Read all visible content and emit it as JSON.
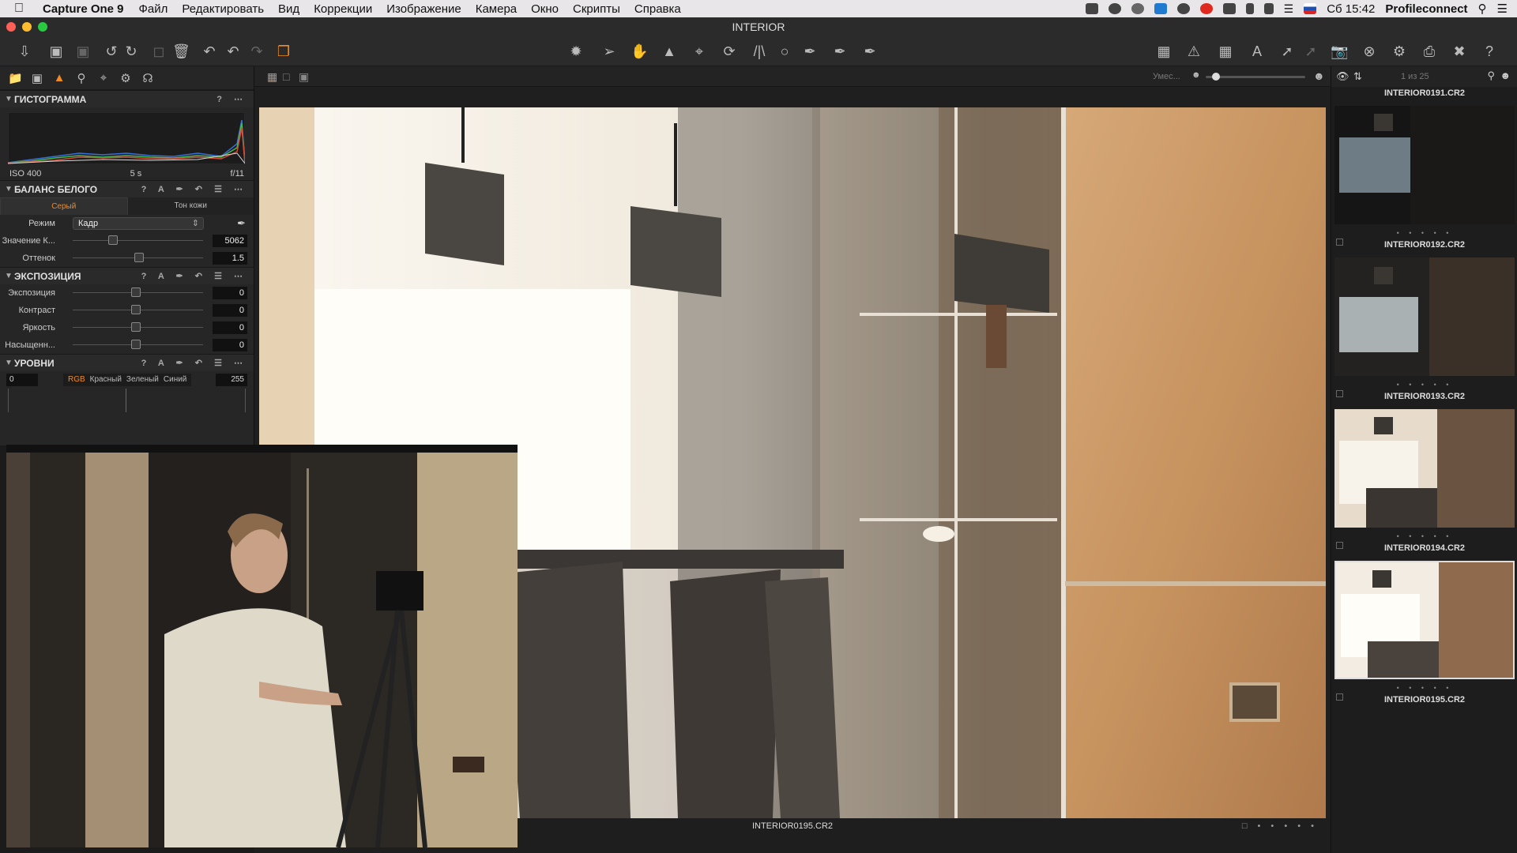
{
  "menubar": {
    "app_name": "Capture One 9",
    "items": [
      "Файл",
      "Редактировать",
      "Вид",
      "Коррекции",
      "Изображение",
      "Камера",
      "Окно",
      "Скрипты",
      "Справка"
    ],
    "clock": "Сб 15:42",
    "user": "Profileconnect"
  },
  "window": {
    "title": "INTERIOR"
  },
  "left_panel": {
    "histogram": {
      "title": "ГИСТОГРАММА",
      "iso": "ISO 400",
      "shutter": "5 s",
      "aperture": "f/11"
    },
    "white_balance": {
      "title": "БАЛАНС БЕЛОГО",
      "tab_gray": "Серый",
      "tab_skin": "Тон кожи",
      "mode_label": "Режим",
      "mode_value": "Кадр",
      "kelvin_label": "Значение К...",
      "kelvin_value": "5062",
      "tint_label": "Оттенок",
      "tint_value": "1.5"
    },
    "exposure": {
      "title": "ЭКСПОЗИЦИЯ",
      "rows": [
        {
          "label": "Экспозиция",
          "value": "0"
        },
        {
          "label": "Контраст",
          "value": "0"
        },
        {
          "label": "Яркость",
          "value": "0"
        },
        {
          "label": "Насыщенн...",
          "value": "0"
        }
      ]
    },
    "levels": {
      "title": "УРОВНИ",
      "low": "0",
      "high": "255",
      "channels": [
        "RGB",
        "Красный",
        "Зеленый",
        "Синий"
      ]
    }
  },
  "viewer": {
    "top_label": "Умес...",
    "filename": "INTERIOR0195.CR2"
  },
  "browser": {
    "counter": "1 из 25",
    "thumbs": [
      {
        "name": "INTERIOR0191.CR2"
      },
      {
        "name": "INTERIOR0192.CR2"
      },
      {
        "name": "INTERIOR0193.CR2"
      },
      {
        "name": "INTERIOR0194.CR2"
      },
      {
        "name": "INTERIOR0195.CR2"
      }
    ]
  },
  "colors": {
    "accent": "#f08a24",
    "panel": "#262626"
  }
}
